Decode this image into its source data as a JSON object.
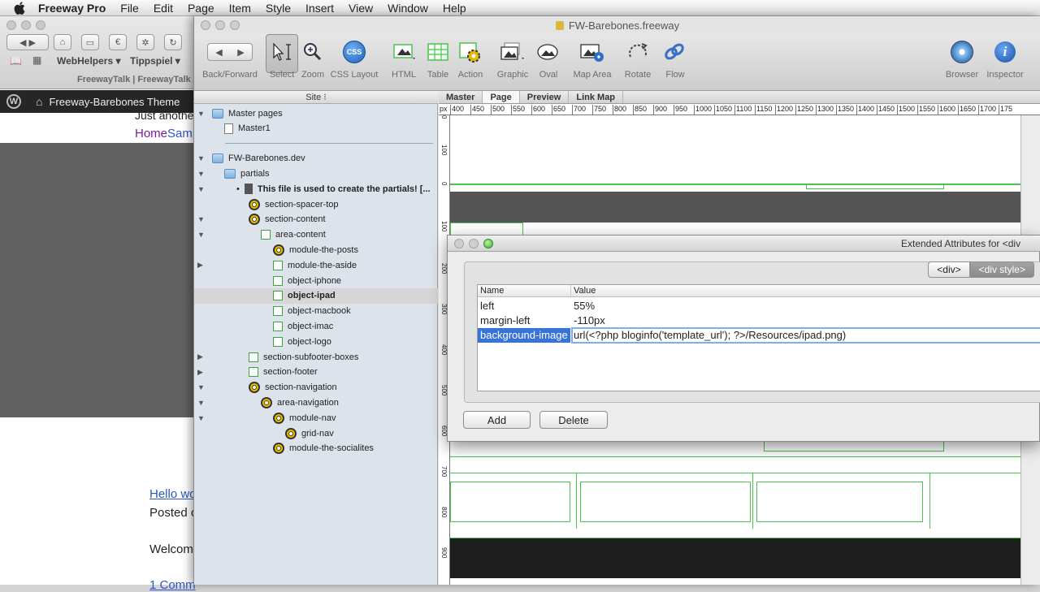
{
  "menubar": {
    "app_name": "Freeway Pro",
    "items": [
      "File",
      "Edit",
      "Page",
      "Item",
      "Style",
      "Insert",
      "View",
      "Window",
      "Help"
    ]
  },
  "browser": {
    "bookmarks": [
      "WebHelpers ▾",
      "Tippspiel ▾"
    ],
    "tab_text": "FreewayTalk | FreewayTalk",
    "wp_site_name": "Freeway-Barebones Theme",
    "tagline_partial": "Just anothe",
    "nav_partial": [
      "Home",
      "Samp"
    ],
    "post_title_partial": "Hello wo",
    "posted_partial": "Posted o",
    "welcome_partial": "Welcom",
    "comments_partial": "1 Comm"
  },
  "window": {
    "title": "FW-Barebones.freeway"
  },
  "toolbar": {
    "items": [
      {
        "label": "Back/Forward",
        "icon": "back-forward-arrows-icon"
      },
      {
        "label": "Select",
        "icon": "select-arrow-icon"
      },
      {
        "label": "Zoom",
        "icon": "zoom-magnifier-icon"
      },
      {
        "label": "CSS Layout",
        "icon": "css-layout-icon",
        "badge": "CSS"
      },
      {
        "label": "HTML",
        "icon": "html-item-icon"
      },
      {
        "label": "Table",
        "icon": "table-icon"
      },
      {
        "label": "Action",
        "icon": "action-gear-icon"
      },
      {
        "label": "Graphic",
        "icon": "graphic-item-icon"
      },
      {
        "label": "Oval",
        "icon": "oval-icon"
      },
      {
        "label": "Map Area",
        "icon": "map-area-icon"
      },
      {
        "label": "Rotate",
        "icon": "rotate-icon"
      },
      {
        "label": "Flow",
        "icon": "flow-link-icon"
      },
      {
        "label": "Browser",
        "icon": "safari-compass-icon"
      },
      {
        "label": "Inspector",
        "icon": "inspector-info-icon"
      }
    ]
  },
  "site_panel": {
    "header": "Site",
    "rows": [
      {
        "label": "Master pages",
        "icon": "folder",
        "indent": 0,
        "tri": "▼",
        "bold": false
      },
      {
        "label": "Master1",
        "icon": "page",
        "indent": 1,
        "tri": "",
        "bold": false
      },
      {
        "label": "FW-Barebones.dev",
        "icon": "folder",
        "indent": 0,
        "tri": "▼",
        "bold": false
      },
      {
        "label": "partials",
        "icon": "folder",
        "indent": 1,
        "tri": "▼",
        "bold": false
      },
      {
        "label": "This file is used to create the partials! [...",
        "icon": "doc",
        "indent": 2,
        "tri": "▼",
        "bold": true,
        "bullet": "•"
      },
      {
        "label": "section-spacer-top",
        "icon": "gear",
        "indent": 3,
        "tri": "",
        "bold": false
      },
      {
        "label": "section-content",
        "icon": "gear",
        "indent": 3,
        "tri": "▼",
        "bold": false
      },
      {
        "label": "area-content",
        "icon": "box",
        "indent": 4,
        "tri": "▼",
        "bold": false
      },
      {
        "label": "module-the-posts",
        "icon": "gear",
        "indent": 5,
        "tri": "",
        "bold": false
      },
      {
        "label": "module-the-aside",
        "icon": "box",
        "indent": 5,
        "tri": "▶",
        "bold": false
      },
      {
        "label": "object-iphone",
        "icon": "box",
        "indent": 5,
        "tri": "",
        "bold": false
      },
      {
        "label": "object-ipad",
        "icon": "box",
        "indent": 5,
        "tri": "",
        "bold": true,
        "selected": true
      },
      {
        "label": "object-macbook",
        "icon": "box",
        "indent": 5,
        "tri": "",
        "bold": false
      },
      {
        "label": "object-imac",
        "icon": "box",
        "indent": 5,
        "tri": "",
        "bold": false
      },
      {
        "label": "object-logo",
        "icon": "box",
        "indent": 5,
        "tri": "",
        "bold": false
      },
      {
        "label": "section-subfooter-boxes",
        "icon": "box",
        "indent": 3,
        "tri": "▶",
        "bold": false
      },
      {
        "label": "section-footer",
        "icon": "box",
        "indent": 3,
        "tri": "▶",
        "bold": false
      },
      {
        "label": "section-navigation",
        "icon": "gear",
        "indent": 3,
        "tri": "▼",
        "bold": false
      },
      {
        "label": "area-navigation",
        "icon": "gear",
        "indent": 4,
        "tri": "▼",
        "bold": false
      },
      {
        "label": "module-nav",
        "icon": "gear",
        "indent": 5,
        "tri": "▼",
        "bold": false
      },
      {
        "label": "grid-nav",
        "icon": "gear",
        "indent": 6,
        "tri": "",
        "bold": false
      },
      {
        "label": "module-the-socialites",
        "icon": "gear",
        "indent": 5,
        "tri": "",
        "bold": false
      }
    ]
  },
  "doc_tabs": [
    "Master",
    "Page",
    "Preview",
    "Link Map"
  ],
  "ruler": {
    "unit": "px",
    "ticks": [
      "400",
      "450",
      "500",
      "550",
      "600",
      "650",
      "700",
      "750",
      "800",
      "850",
      "900",
      "950",
      "1000",
      "1050",
      "1100",
      "1150",
      "1200",
      "1250",
      "1300",
      "1350",
      "1400",
      "1450",
      "1500",
      "1550",
      "1600",
      "1650",
      "1700",
      "175"
    ],
    "v_ticks": [
      "0",
      "100",
      "0",
      "100",
      "200",
      "300",
      "400",
      "500",
      "600",
      "700",
      "800",
      "900"
    ]
  },
  "dialog": {
    "title": "Extended Attributes for <div",
    "segments": [
      "<div>",
      "<div style>"
    ],
    "active_segment": 1,
    "columns": [
      "Name",
      "Value"
    ],
    "rows": [
      {
        "name": "left",
        "value": "55%"
      },
      {
        "name": "margin-left",
        "value": "-110px"
      },
      {
        "name": "background-image",
        "value": "url(<?php bloginfo('template_url'); ?>/Resources/ipad.png)",
        "selected": true
      }
    ],
    "add_label": "Add",
    "delete_label": "Delete"
  },
  "colors": {
    "selection": "#3874d8",
    "guide_green": "#4cc24c",
    "canvas_dark": "#555555",
    "footer_dark": "#1e1e1e"
  }
}
